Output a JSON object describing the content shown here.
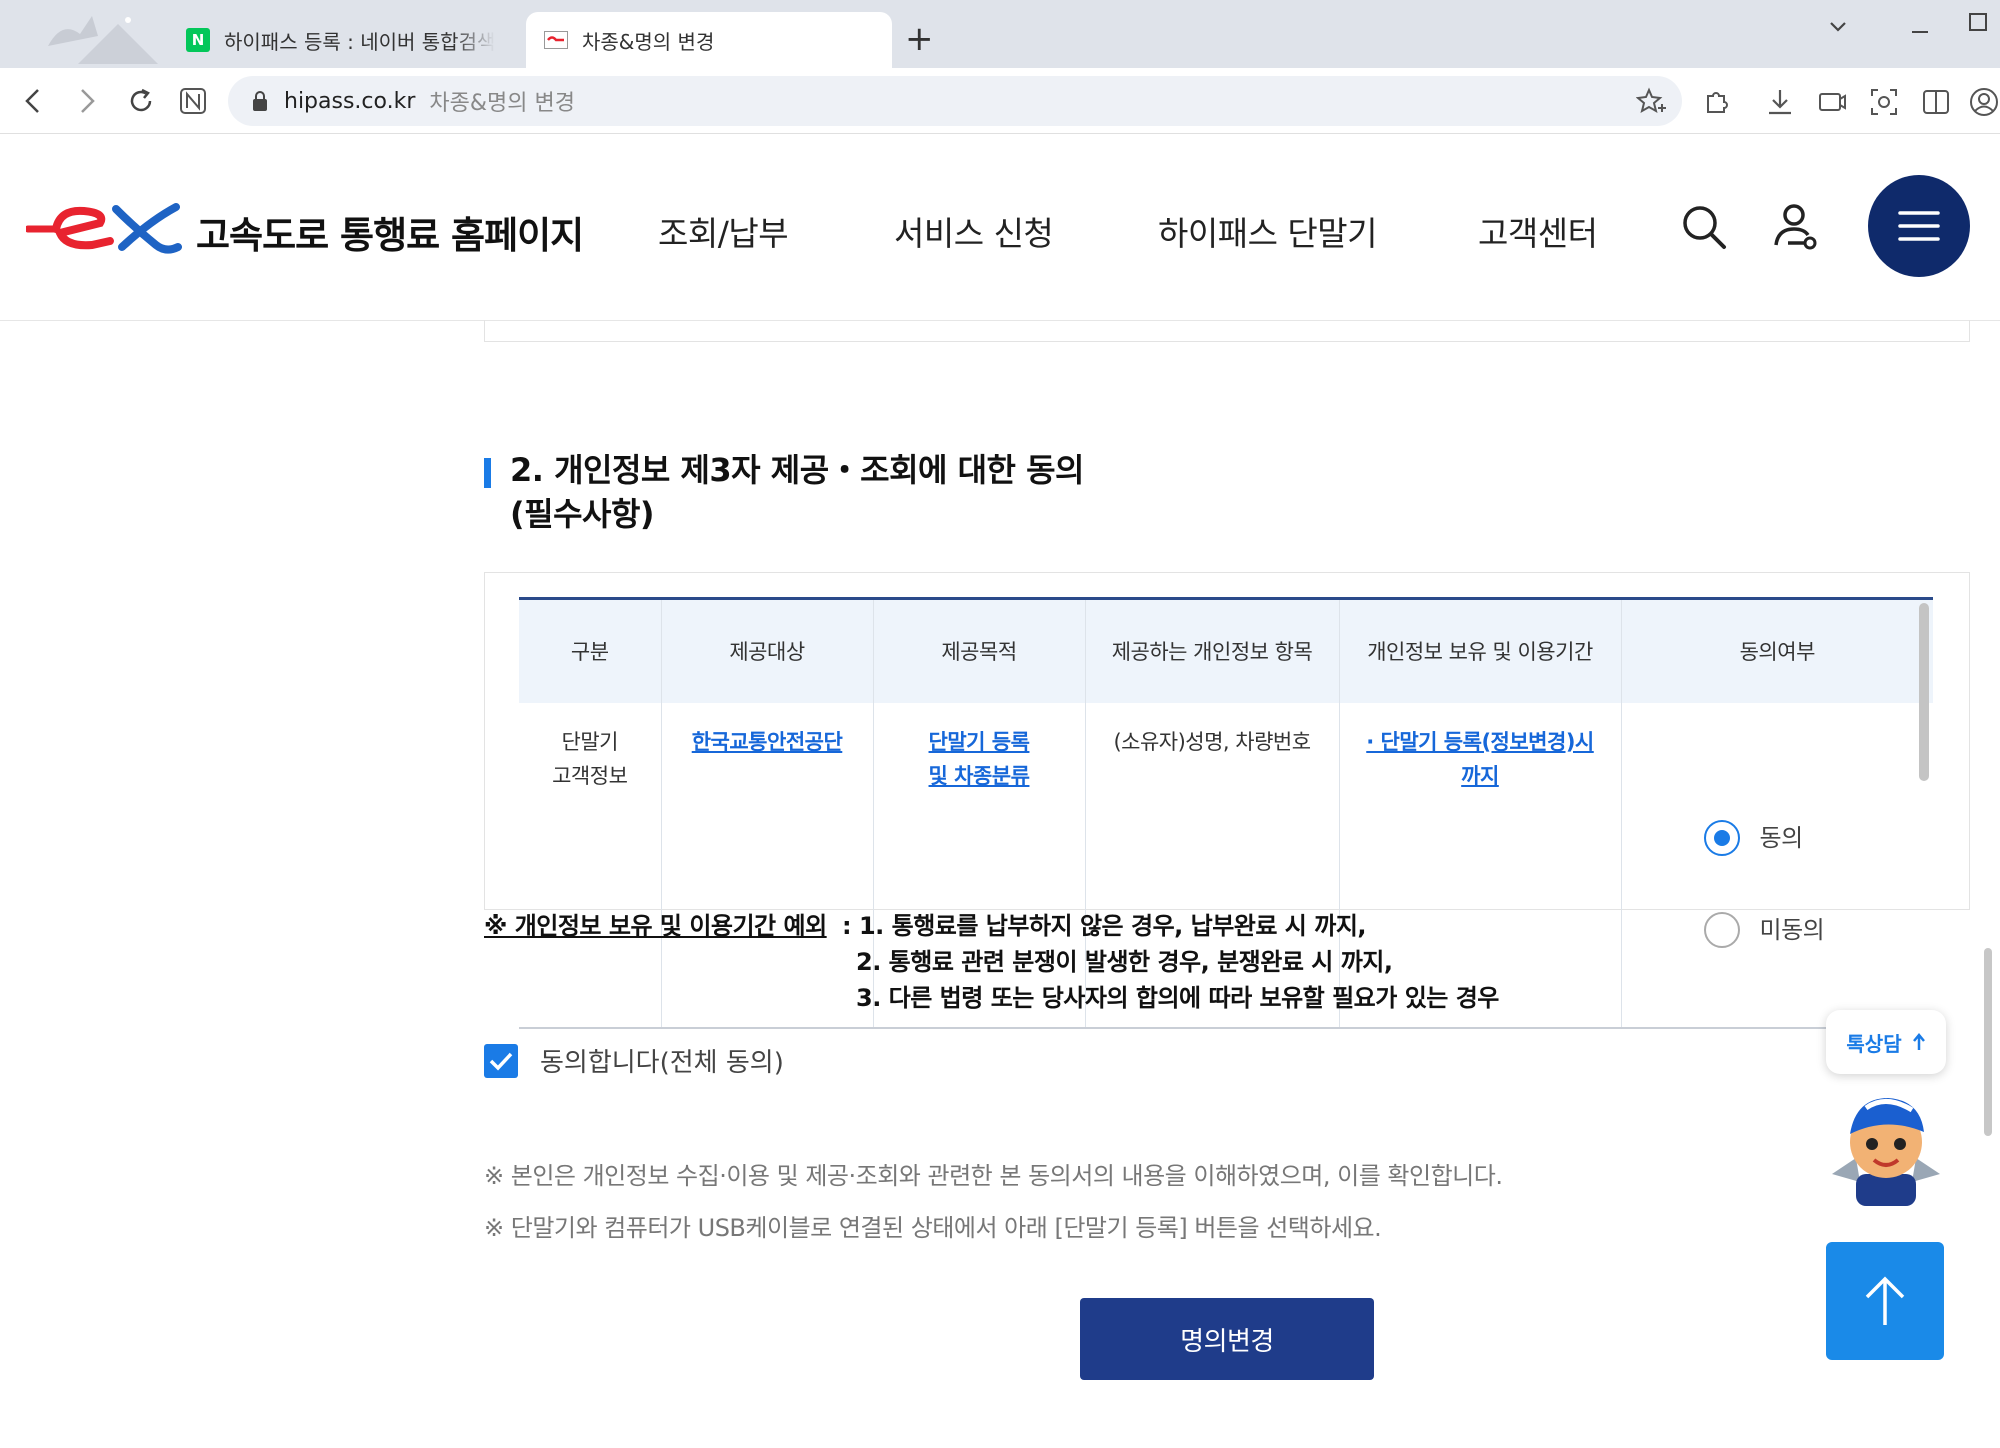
{
  "browser": {
    "tabs": [
      {
        "label": "하이패스 등록 : 네이버 통합검색",
        "active": false
      },
      {
        "label": "차종&명의 변경",
        "active": true
      }
    ],
    "new_tab_label": "+",
    "url": {
      "domain": "hipass.co.kr",
      "page_title": "차종&명의 변경"
    }
  },
  "header": {
    "site_name": "고속도로 통행료 홈페이지",
    "nav": [
      "조회/납부",
      "서비스 신청",
      "하이패스 단말기",
      "고객센터"
    ],
    "colors": {
      "brand_red": "#e8232f",
      "brand_blue": "#1e63c4",
      "menu_bg": "#0f2a6b"
    }
  },
  "section": {
    "title": "2. 개인정보 제3자 제공・조회에 대한 동의\n(필수사항)"
  },
  "consent_table": {
    "headers": [
      "구분",
      "제공대상",
      "제공목적",
      "제공하는 개인정보 항목",
      "개인정보 보유 및 이용기간",
      "동의여부"
    ],
    "row": {
      "category": "단말기\n고객정보",
      "recipient": "한국교통안전공단",
      "purpose": "단말기 등록\n및 차종분류",
      "items": "(소유자)성명, 차량번호",
      "retention": "· 단말기 등록(정보변경)시\n까지"
    },
    "options": [
      {
        "label": "동의",
        "selected": true
      },
      {
        "label": "미동의",
        "selected": false
      }
    ]
  },
  "notice": {
    "label": "※ 개인정보 보유 및 이용기간 예외",
    "items": [
      ": 1. 통행료를 납부하지 않은 경우, 납부완료 시 까지,",
      "2. 통행료 관련 분쟁이 발생한 경우, 분쟁완료 시 까지,",
      "3. 다른 법령 또는 당사자의 합의에 따라 보유할 필요가 있는 경우"
    ]
  },
  "agree_all": {
    "label": "동의합니다(전체 동의)",
    "checked": true
  },
  "disclaimers": [
    "※ 본인은 개인정보 수집·이용 및 제공·조회와 관련한 본 동의서의 내용을 이해하였으며, 이를 확인합니다.",
    "※ 단말기와 컴퓨터가 USB케이블로 연결된 상태에서 아래 [단말기 등록] 버튼을 선택하세요."
  ],
  "submit_label": "명의변경",
  "chatbot": {
    "label": "톡상담"
  },
  "accent_color": "#1a7be6"
}
